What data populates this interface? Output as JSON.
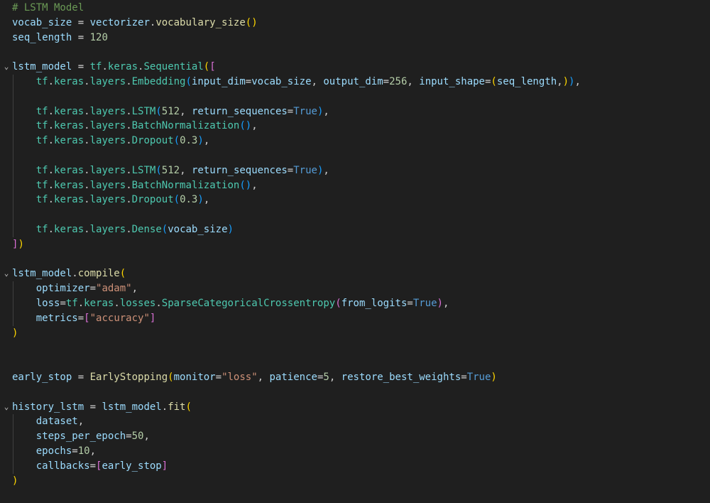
{
  "colors": {
    "background": "#1f1f1f",
    "default": "#cccccc",
    "comment": "#6a9955",
    "variable": "#9cdcfe",
    "function": "#dcdcaa",
    "class": "#4ec9b0",
    "string": "#ce9178",
    "number": "#b5cea8",
    "keyword": "#569cd6",
    "operator": "#d4d4d4",
    "bracket1": "#ffd700",
    "bracket2": "#da70d6",
    "bracket3": "#179fff"
  },
  "editor": {
    "language": "python",
    "lines": [
      {
        "fold": false,
        "guide": false,
        "tokens": [
          {
            "t": "# LSTM Model",
            "c": "comment"
          }
        ]
      },
      {
        "fold": false,
        "guide": false,
        "tokens": [
          {
            "t": "vocab_size",
            "c": "variable"
          },
          {
            "t": " = ",
            "c": "operator"
          },
          {
            "t": "vectorizer",
            "c": "variable"
          },
          {
            "t": ".",
            "c": "default"
          },
          {
            "t": "vocabulary_size",
            "c": "function"
          },
          {
            "t": "()",
            "c": "bracket1"
          }
        ]
      },
      {
        "fold": false,
        "guide": false,
        "tokens": [
          {
            "t": "seq_length",
            "c": "variable"
          },
          {
            "t": " = ",
            "c": "operator"
          },
          {
            "t": "120",
            "c": "number"
          }
        ]
      },
      {
        "fold": false,
        "guide": false,
        "tokens": []
      },
      {
        "fold": true,
        "guide": false,
        "tokens": [
          {
            "t": "lstm_model",
            "c": "variable"
          },
          {
            "t": " = ",
            "c": "operator"
          },
          {
            "t": "tf",
            "c": "class"
          },
          {
            "t": ".",
            "c": "default"
          },
          {
            "t": "keras",
            "c": "class"
          },
          {
            "t": ".",
            "c": "default"
          },
          {
            "t": "Sequential",
            "c": "class"
          },
          {
            "t": "(",
            "c": "bracket1"
          },
          {
            "t": "[",
            "c": "bracket2"
          }
        ]
      },
      {
        "fold": false,
        "guide": true,
        "tokens": [
          {
            "t": "    ",
            "c": "default"
          },
          {
            "t": "tf",
            "c": "class"
          },
          {
            "t": ".",
            "c": "default"
          },
          {
            "t": "keras",
            "c": "class"
          },
          {
            "t": ".",
            "c": "default"
          },
          {
            "t": "layers",
            "c": "class"
          },
          {
            "t": ".",
            "c": "default"
          },
          {
            "t": "Embedding",
            "c": "class"
          },
          {
            "t": "(",
            "c": "bracket3"
          },
          {
            "t": "input_dim",
            "c": "variable"
          },
          {
            "t": "=",
            "c": "operator"
          },
          {
            "t": "vocab_size",
            "c": "variable"
          },
          {
            "t": ", ",
            "c": "default"
          },
          {
            "t": "output_dim",
            "c": "variable"
          },
          {
            "t": "=",
            "c": "operator"
          },
          {
            "t": "256",
            "c": "number"
          },
          {
            "t": ", ",
            "c": "default"
          },
          {
            "t": "input_shape",
            "c": "variable"
          },
          {
            "t": "=",
            "c": "operator"
          },
          {
            "t": "(",
            "c": "bracket1"
          },
          {
            "t": "seq_length",
            "c": "variable"
          },
          {
            "t": ",",
            "c": "default"
          },
          {
            "t": ")",
            "c": "bracket1"
          },
          {
            "t": ")",
            "c": "bracket3"
          },
          {
            "t": ",",
            "c": "default"
          }
        ]
      },
      {
        "fold": false,
        "guide": true,
        "tokens": []
      },
      {
        "fold": false,
        "guide": true,
        "tokens": [
          {
            "t": "    ",
            "c": "default"
          },
          {
            "t": "tf",
            "c": "class"
          },
          {
            "t": ".",
            "c": "default"
          },
          {
            "t": "keras",
            "c": "class"
          },
          {
            "t": ".",
            "c": "default"
          },
          {
            "t": "layers",
            "c": "class"
          },
          {
            "t": ".",
            "c": "default"
          },
          {
            "t": "LSTM",
            "c": "class"
          },
          {
            "t": "(",
            "c": "bracket3"
          },
          {
            "t": "512",
            "c": "number"
          },
          {
            "t": ", ",
            "c": "default"
          },
          {
            "t": "return_sequences",
            "c": "variable"
          },
          {
            "t": "=",
            "c": "operator"
          },
          {
            "t": "True",
            "c": "keyword"
          },
          {
            "t": ")",
            "c": "bracket3"
          },
          {
            "t": ",",
            "c": "default"
          }
        ]
      },
      {
        "fold": false,
        "guide": true,
        "tokens": [
          {
            "t": "    ",
            "c": "default"
          },
          {
            "t": "tf",
            "c": "class"
          },
          {
            "t": ".",
            "c": "default"
          },
          {
            "t": "keras",
            "c": "class"
          },
          {
            "t": ".",
            "c": "default"
          },
          {
            "t": "layers",
            "c": "class"
          },
          {
            "t": ".",
            "c": "default"
          },
          {
            "t": "BatchNormalization",
            "c": "class"
          },
          {
            "t": "()",
            "c": "bracket3"
          },
          {
            "t": ",",
            "c": "default"
          }
        ]
      },
      {
        "fold": false,
        "guide": true,
        "tokens": [
          {
            "t": "    ",
            "c": "default"
          },
          {
            "t": "tf",
            "c": "class"
          },
          {
            "t": ".",
            "c": "default"
          },
          {
            "t": "keras",
            "c": "class"
          },
          {
            "t": ".",
            "c": "default"
          },
          {
            "t": "layers",
            "c": "class"
          },
          {
            "t": ".",
            "c": "default"
          },
          {
            "t": "Dropout",
            "c": "class"
          },
          {
            "t": "(",
            "c": "bracket3"
          },
          {
            "t": "0.3",
            "c": "number"
          },
          {
            "t": ")",
            "c": "bracket3"
          },
          {
            "t": ",",
            "c": "default"
          }
        ]
      },
      {
        "fold": false,
        "guide": true,
        "tokens": []
      },
      {
        "fold": false,
        "guide": true,
        "tokens": [
          {
            "t": "    ",
            "c": "default"
          },
          {
            "t": "tf",
            "c": "class"
          },
          {
            "t": ".",
            "c": "default"
          },
          {
            "t": "keras",
            "c": "class"
          },
          {
            "t": ".",
            "c": "default"
          },
          {
            "t": "layers",
            "c": "class"
          },
          {
            "t": ".",
            "c": "default"
          },
          {
            "t": "LSTM",
            "c": "class"
          },
          {
            "t": "(",
            "c": "bracket3"
          },
          {
            "t": "512",
            "c": "number"
          },
          {
            "t": ", ",
            "c": "default"
          },
          {
            "t": "return_sequences",
            "c": "variable"
          },
          {
            "t": "=",
            "c": "operator"
          },
          {
            "t": "True",
            "c": "keyword"
          },
          {
            "t": ")",
            "c": "bracket3"
          },
          {
            "t": ",",
            "c": "default"
          }
        ]
      },
      {
        "fold": false,
        "guide": true,
        "tokens": [
          {
            "t": "    ",
            "c": "default"
          },
          {
            "t": "tf",
            "c": "class"
          },
          {
            "t": ".",
            "c": "default"
          },
          {
            "t": "keras",
            "c": "class"
          },
          {
            "t": ".",
            "c": "default"
          },
          {
            "t": "layers",
            "c": "class"
          },
          {
            "t": ".",
            "c": "default"
          },
          {
            "t": "BatchNormalization",
            "c": "class"
          },
          {
            "t": "()",
            "c": "bracket3"
          },
          {
            "t": ",",
            "c": "default"
          }
        ]
      },
      {
        "fold": false,
        "guide": true,
        "tokens": [
          {
            "t": "    ",
            "c": "default"
          },
          {
            "t": "tf",
            "c": "class"
          },
          {
            "t": ".",
            "c": "default"
          },
          {
            "t": "keras",
            "c": "class"
          },
          {
            "t": ".",
            "c": "default"
          },
          {
            "t": "layers",
            "c": "class"
          },
          {
            "t": ".",
            "c": "default"
          },
          {
            "t": "Dropout",
            "c": "class"
          },
          {
            "t": "(",
            "c": "bracket3"
          },
          {
            "t": "0.3",
            "c": "number"
          },
          {
            "t": ")",
            "c": "bracket3"
          },
          {
            "t": ",",
            "c": "default"
          }
        ]
      },
      {
        "fold": false,
        "guide": true,
        "tokens": []
      },
      {
        "fold": false,
        "guide": true,
        "tokens": [
          {
            "t": "    ",
            "c": "default"
          },
          {
            "t": "tf",
            "c": "class"
          },
          {
            "t": ".",
            "c": "default"
          },
          {
            "t": "keras",
            "c": "class"
          },
          {
            "t": ".",
            "c": "default"
          },
          {
            "t": "layers",
            "c": "class"
          },
          {
            "t": ".",
            "c": "default"
          },
          {
            "t": "Dense",
            "c": "class"
          },
          {
            "t": "(",
            "c": "bracket3"
          },
          {
            "t": "vocab_size",
            "c": "variable"
          },
          {
            "t": ")",
            "c": "bracket3"
          }
        ]
      },
      {
        "fold": false,
        "guide": false,
        "tokens": [
          {
            "t": "]",
            "c": "bracket2"
          },
          {
            "t": ")",
            "c": "bracket1"
          }
        ]
      },
      {
        "fold": false,
        "guide": false,
        "tokens": []
      },
      {
        "fold": true,
        "guide": false,
        "tokens": [
          {
            "t": "lstm_model",
            "c": "variable"
          },
          {
            "t": ".",
            "c": "default"
          },
          {
            "t": "compile",
            "c": "function"
          },
          {
            "t": "(",
            "c": "bracket1"
          }
        ]
      },
      {
        "fold": false,
        "guide": true,
        "tokens": [
          {
            "t": "    ",
            "c": "default"
          },
          {
            "t": "optimizer",
            "c": "variable"
          },
          {
            "t": "=",
            "c": "operator"
          },
          {
            "t": "\"adam\"",
            "c": "string"
          },
          {
            "t": ",",
            "c": "default"
          }
        ]
      },
      {
        "fold": false,
        "guide": true,
        "tokens": [
          {
            "t": "    ",
            "c": "default"
          },
          {
            "t": "loss",
            "c": "variable"
          },
          {
            "t": "=",
            "c": "operator"
          },
          {
            "t": "tf",
            "c": "class"
          },
          {
            "t": ".",
            "c": "default"
          },
          {
            "t": "keras",
            "c": "class"
          },
          {
            "t": ".",
            "c": "default"
          },
          {
            "t": "losses",
            "c": "class"
          },
          {
            "t": ".",
            "c": "default"
          },
          {
            "t": "SparseCategoricalCrossentropy",
            "c": "class"
          },
          {
            "t": "(",
            "c": "bracket2"
          },
          {
            "t": "from_logits",
            "c": "variable"
          },
          {
            "t": "=",
            "c": "operator"
          },
          {
            "t": "True",
            "c": "keyword"
          },
          {
            "t": ")",
            "c": "bracket2"
          },
          {
            "t": ",",
            "c": "default"
          }
        ]
      },
      {
        "fold": false,
        "guide": true,
        "tokens": [
          {
            "t": "    ",
            "c": "default"
          },
          {
            "t": "metrics",
            "c": "variable"
          },
          {
            "t": "=",
            "c": "operator"
          },
          {
            "t": "[",
            "c": "bracket2"
          },
          {
            "t": "\"accuracy\"",
            "c": "string"
          },
          {
            "t": "]",
            "c": "bracket2"
          }
        ]
      },
      {
        "fold": false,
        "guide": false,
        "tokens": [
          {
            "t": ")",
            "c": "bracket1"
          }
        ]
      },
      {
        "fold": false,
        "guide": false,
        "tokens": []
      },
      {
        "fold": false,
        "guide": false,
        "tokens": []
      },
      {
        "fold": false,
        "guide": false,
        "tokens": [
          {
            "t": "early_stop",
            "c": "variable"
          },
          {
            "t": " = ",
            "c": "operator"
          },
          {
            "t": "EarlyStopping",
            "c": "function"
          },
          {
            "t": "(",
            "c": "bracket1"
          },
          {
            "t": "monitor",
            "c": "variable"
          },
          {
            "t": "=",
            "c": "operator"
          },
          {
            "t": "\"loss\"",
            "c": "string"
          },
          {
            "t": ", ",
            "c": "default"
          },
          {
            "t": "patience",
            "c": "variable"
          },
          {
            "t": "=",
            "c": "operator"
          },
          {
            "t": "5",
            "c": "number"
          },
          {
            "t": ", ",
            "c": "default"
          },
          {
            "t": "restore_best_weights",
            "c": "variable"
          },
          {
            "t": "=",
            "c": "operator"
          },
          {
            "t": "True",
            "c": "keyword"
          },
          {
            "t": ")",
            "c": "bracket1"
          }
        ]
      },
      {
        "fold": false,
        "guide": false,
        "tokens": []
      },
      {
        "fold": true,
        "guide": false,
        "tokens": [
          {
            "t": "history_lstm",
            "c": "variable"
          },
          {
            "t": " = ",
            "c": "operator"
          },
          {
            "t": "lstm_model",
            "c": "variable"
          },
          {
            "t": ".",
            "c": "default"
          },
          {
            "t": "fit",
            "c": "function"
          },
          {
            "t": "(",
            "c": "bracket1"
          }
        ]
      },
      {
        "fold": false,
        "guide": true,
        "tokens": [
          {
            "t": "    ",
            "c": "default"
          },
          {
            "t": "dataset",
            "c": "variable"
          },
          {
            "t": ",",
            "c": "default"
          }
        ]
      },
      {
        "fold": false,
        "guide": true,
        "tokens": [
          {
            "t": "    ",
            "c": "default"
          },
          {
            "t": "steps_per_epoch",
            "c": "variable"
          },
          {
            "t": "=",
            "c": "operator"
          },
          {
            "t": "50",
            "c": "number"
          },
          {
            "t": ",",
            "c": "default"
          }
        ]
      },
      {
        "fold": false,
        "guide": true,
        "tokens": [
          {
            "t": "    ",
            "c": "default"
          },
          {
            "t": "epochs",
            "c": "variable"
          },
          {
            "t": "=",
            "c": "operator"
          },
          {
            "t": "10",
            "c": "number"
          },
          {
            "t": ",",
            "c": "default"
          }
        ]
      },
      {
        "fold": false,
        "guide": true,
        "tokens": [
          {
            "t": "    ",
            "c": "default"
          },
          {
            "t": "callbacks",
            "c": "variable"
          },
          {
            "t": "=",
            "c": "operator"
          },
          {
            "t": "[",
            "c": "bracket2"
          },
          {
            "t": "early_stop",
            "c": "variable"
          },
          {
            "t": "]",
            "c": "bracket2"
          }
        ]
      },
      {
        "fold": false,
        "guide": false,
        "tokens": [
          {
            "t": ")",
            "c": "bracket1"
          }
        ]
      }
    ]
  }
}
